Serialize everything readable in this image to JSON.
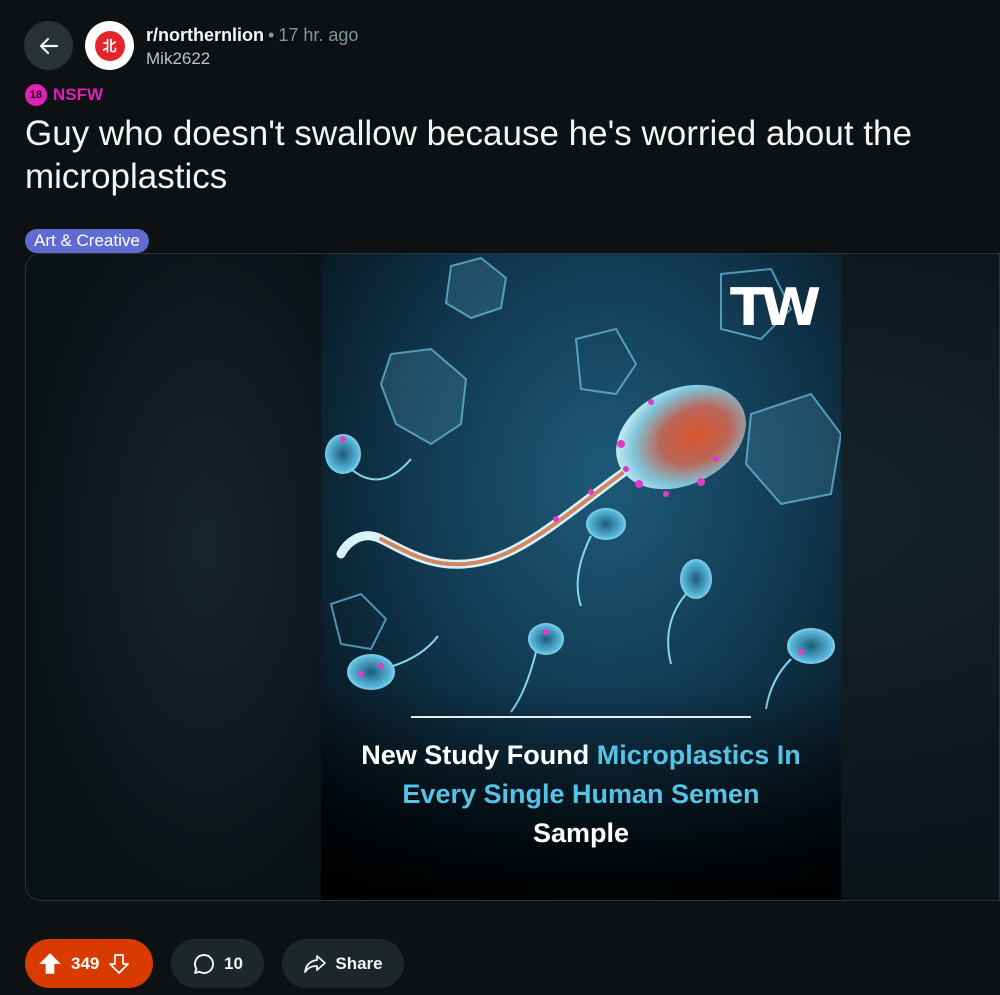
{
  "header": {
    "subreddit": "r/northernlion",
    "separator": "•",
    "time": "17 hr. ago",
    "username": "Mik2622",
    "avatar_glyph": "北",
    "back_icon": "arrow-left-icon"
  },
  "post": {
    "nsfw_badge": "18",
    "nsfw_label": "NSFW",
    "title": "Guy who doesn't swallow because he's worried about the microplastics",
    "flair": "Art & Creative",
    "flair_color": "#5f6bd0"
  },
  "image": {
    "logo": "TW",
    "headline_white_1": "New Study Found ",
    "headline_cyan_1": "Microplastics In",
    "headline_cyan_2": "Every Single Human Semen",
    "headline_white_2": "Sample"
  },
  "actions": {
    "upvotes": "349",
    "comments": "10",
    "share_label": "Share",
    "vote_color": "#d93a00"
  }
}
